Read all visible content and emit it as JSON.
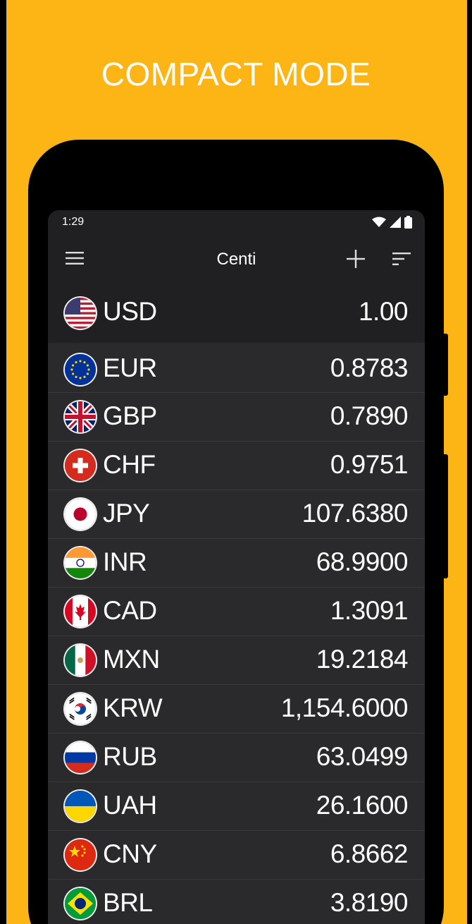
{
  "headline": "COMPACT MODE",
  "colors": {
    "background": "#FDB515",
    "phone_body": "#000000",
    "screen": "#2A2A2C",
    "toolbar": "#202022",
    "text": "#FFFFFF"
  },
  "status_bar": {
    "time": "1:29",
    "icons": [
      "wifi-icon",
      "signal-icon",
      "battery-icon"
    ]
  },
  "app_bar": {
    "title": "Centi",
    "icons": [
      "menu-icon",
      "add-icon",
      "sort-icon"
    ]
  },
  "base_currency": {
    "code": "USD",
    "amount": "1.00",
    "flag": "flag-us-icon"
  },
  "currencies": [
    {
      "code": "EUR",
      "amount": "0.8783",
      "flag": "flag-eu-icon"
    },
    {
      "code": "GBP",
      "amount": "0.7890",
      "flag": "flag-gb-icon"
    },
    {
      "code": "CHF",
      "amount": "0.9751",
      "flag": "flag-ch-icon"
    },
    {
      "code": "JPY",
      "amount": "107.6380",
      "flag": "flag-jp-icon"
    },
    {
      "code": "INR",
      "amount": "68.9900",
      "flag": "flag-in-icon"
    },
    {
      "code": "CAD",
      "amount": "1.3091",
      "flag": "flag-ca-icon"
    },
    {
      "code": "MXN",
      "amount": "19.2184",
      "flag": "flag-mx-icon"
    },
    {
      "code": "KRW",
      "amount": "1,154.6000",
      "flag": "flag-kr-icon"
    },
    {
      "code": "RUB",
      "amount": "63.0499",
      "flag": "flag-ru-icon"
    },
    {
      "code": "UAH",
      "amount": "26.1600",
      "flag": "flag-ua-icon"
    },
    {
      "code": "CNY",
      "amount": "6.8662",
      "flag": "flag-cn-icon"
    },
    {
      "code": "BRL",
      "amount": "3.8190",
      "flag": "flag-br-icon"
    }
  ]
}
